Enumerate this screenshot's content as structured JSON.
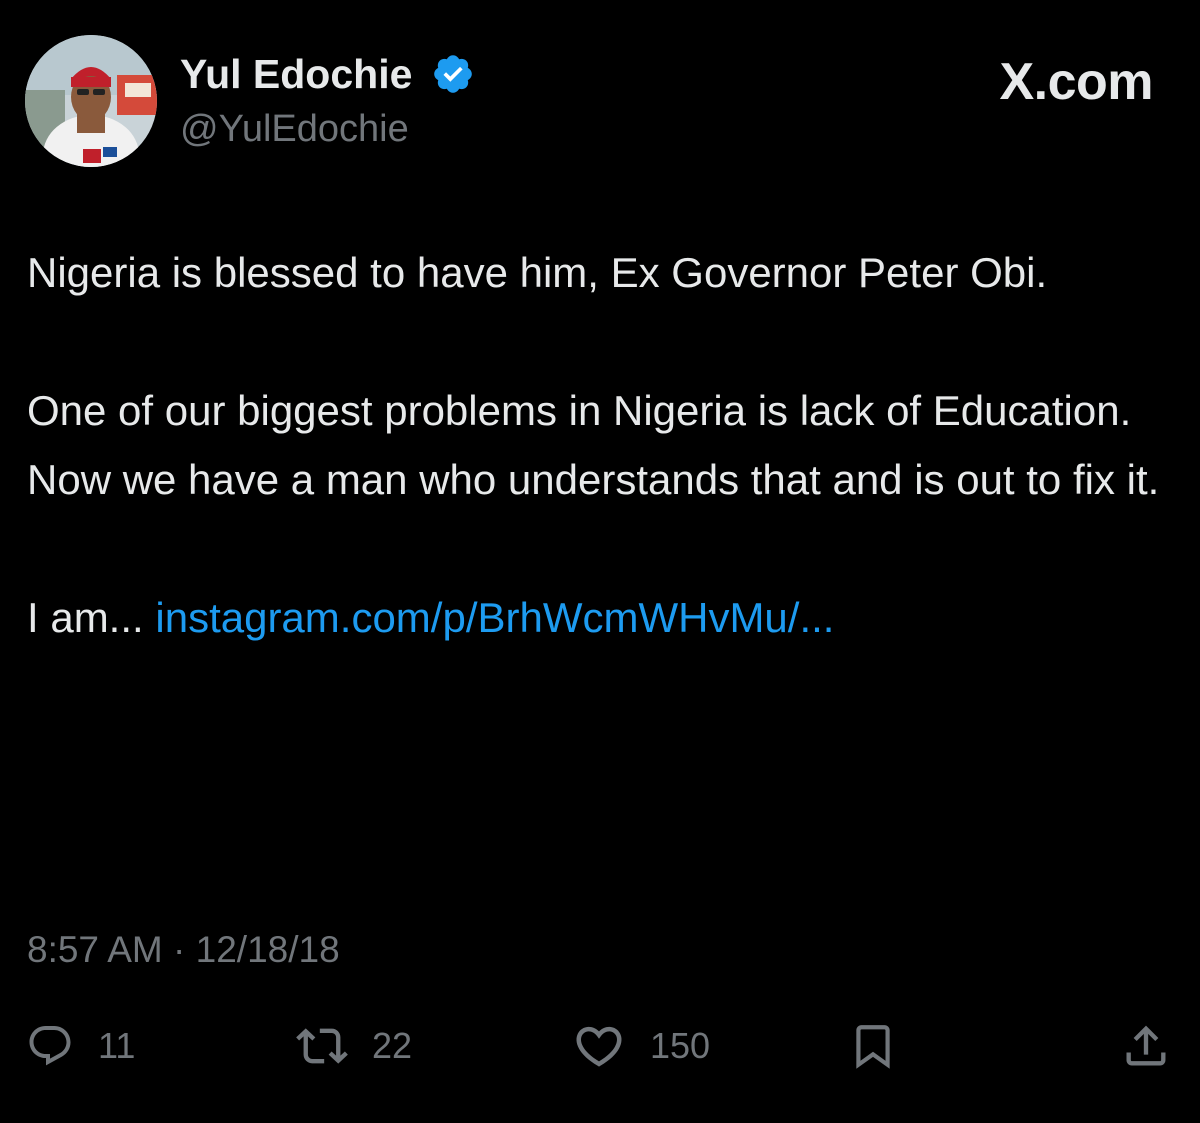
{
  "author": {
    "display_name": "Yul Edochie",
    "handle": "@YulEdochie",
    "verified": true,
    "avatar_icon": "profile-photo"
  },
  "site_logo": "X.com",
  "tweet": {
    "paragraph_1": "Nigeria is blessed to have him, Ex Governor Peter Obi.",
    "paragraph_2": "One of our biggest problems in Nigeria is lack of Education.",
    "paragraph_3": "Now we have a man who understands that and is out to fix it.",
    "paragraph_4_prefix": "I am...",
    "link_text": "instagram.com/p/BrhWcmWHvMu/..."
  },
  "timestamp": "8:57 AM · 12/18/18",
  "actions": {
    "reply_count": "11",
    "retweet_count": "22",
    "like_count": "150"
  },
  "colors": {
    "background": "#000000",
    "text": "#e7e9ea",
    "secondary_text": "#71767b",
    "link": "#1d9bf0",
    "verified_badge": "#1d9bf0"
  }
}
